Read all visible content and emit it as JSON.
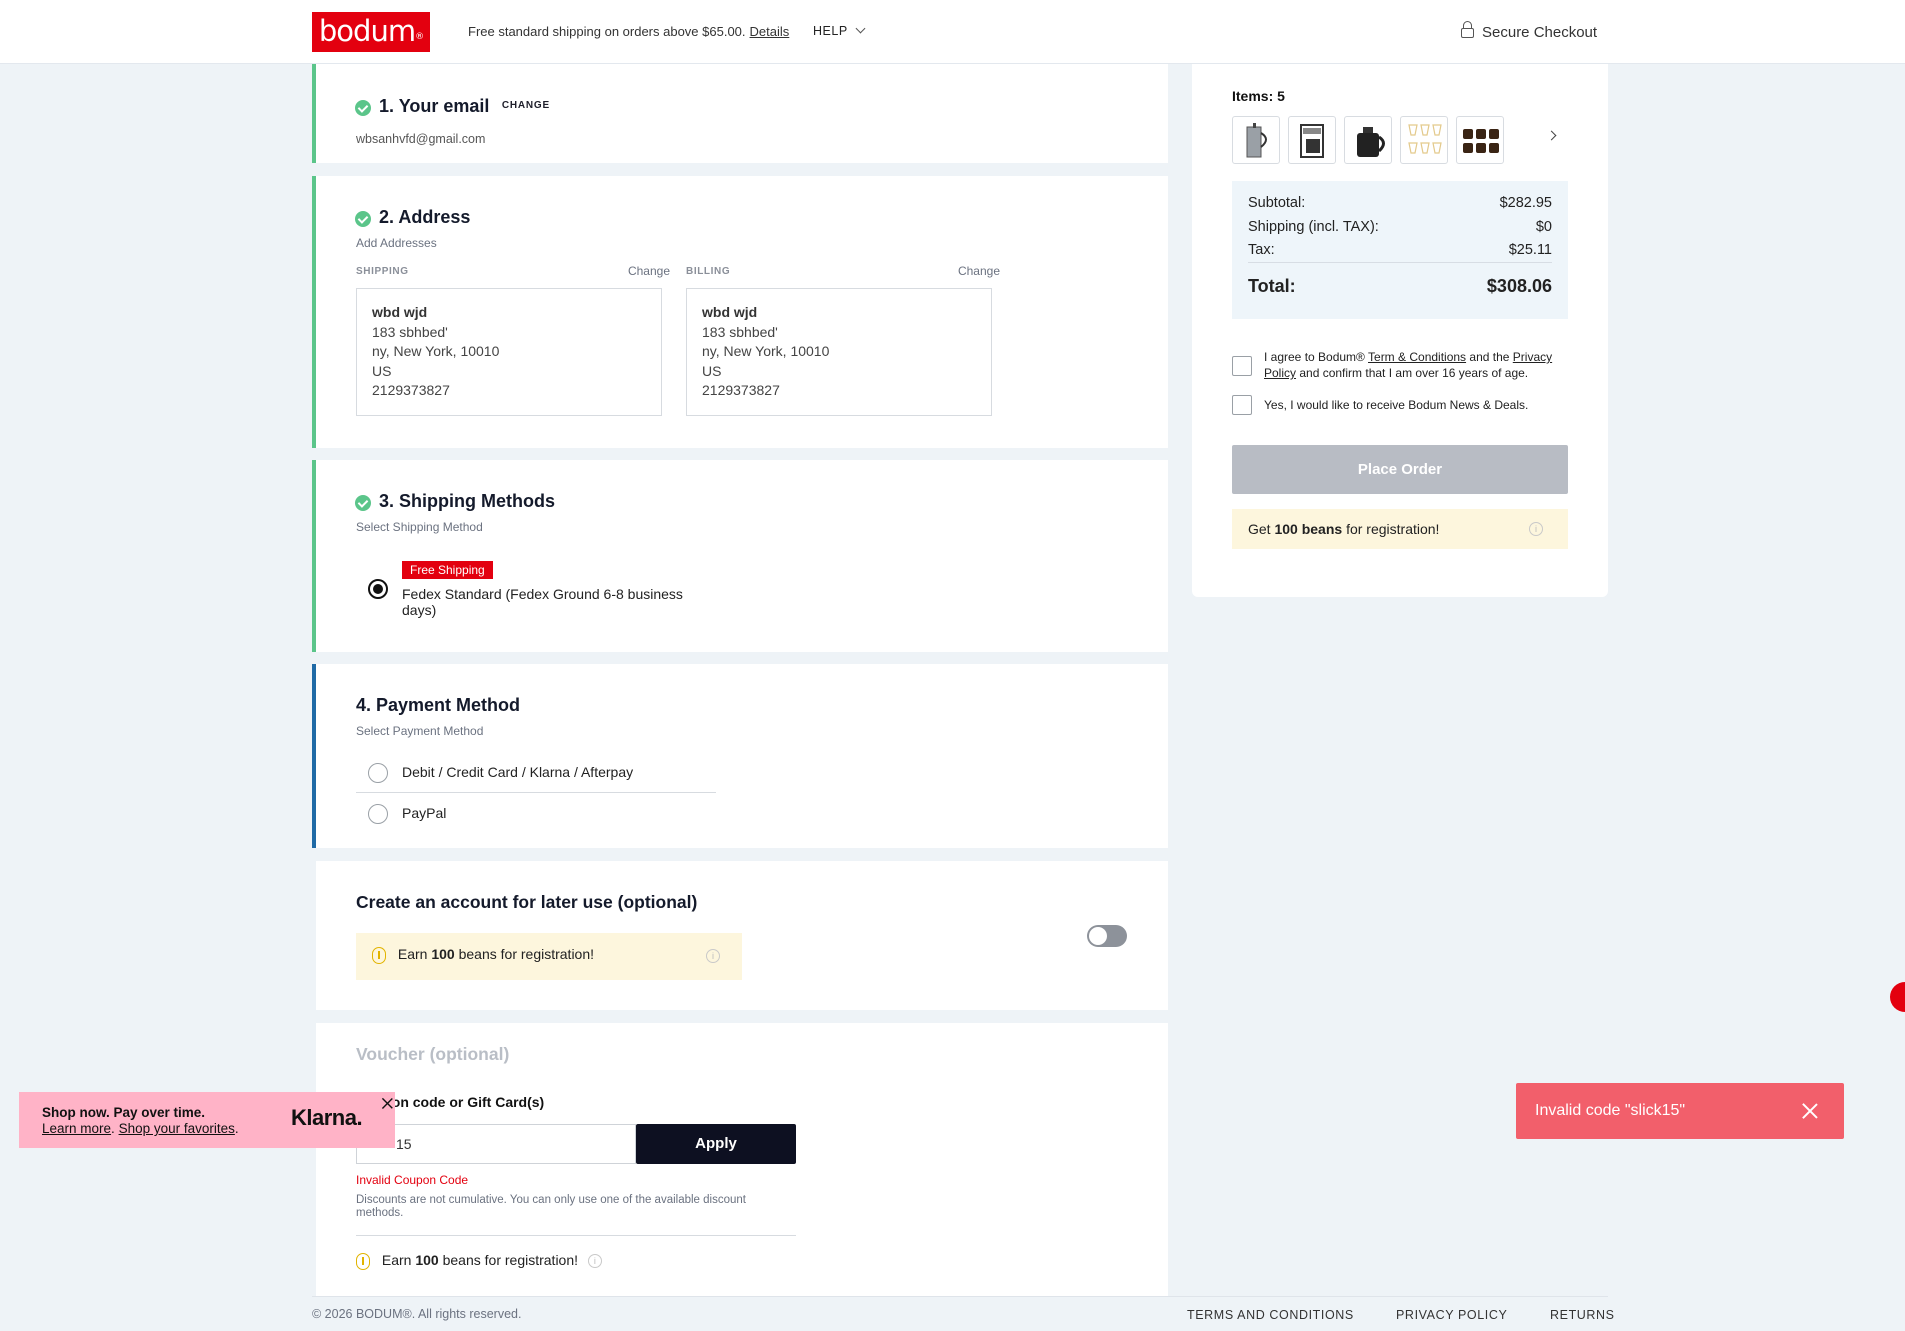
{
  "header": {
    "logo": "bodum",
    "logo_mark": "®",
    "shipping_note": "Free standard shipping on orders above $65.00.",
    "details_link": "Details",
    "help": "HELP",
    "secure_checkout": "Secure Checkout"
  },
  "email_section": {
    "title": "1. Your email",
    "change": "CHANGE",
    "email": "wbsanhvfd@gmail.com"
  },
  "address_section": {
    "title": "2. Address",
    "subtitle": "Add Addresses",
    "shipping_label": "SHIPPING",
    "billing_label": "BILLING",
    "change": "Change",
    "shipping": {
      "name": "wbd wjd",
      "line1": "183 sbhbed'",
      "line2": "ny, New York, 10010",
      "country": "US",
      "phone": "2129373827"
    },
    "billing": {
      "name": "wbd wjd",
      "line1": "183 sbhbed'",
      "line2": "ny, New York, 10010",
      "country": "US",
      "phone": "2129373827"
    }
  },
  "shipping_section": {
    "title": "3. Shipping Methods",
    "subtitle": "Select Shipping Method",
    "badge": "Free Shipping",
    "method_line1": "Fedex Standard (Fedex Ground 6-8 business",
    "method_line2": "days)"
  },
  "payment_section": {
    "title": "4. Payment Method",
    "subtitle": "Select Payment Method",
    "options": [
      "Debit / Credit Card / Klarna / Afterpay",
      "PayPal"
    ]
  },
  "account_section": {
    "title": "Create an account for later use (optional)",
    "beans_pre": "Earn",
    "beans_num": "100",
    "beans_post": "beans for registration!"
  },
  "voucher_section": {
    "title": "Voucher (optional)",
    "coupon_label": "Coupon code or Gift Card(s)",
    "coupon_value": "15",
    "apply": "Apply",
    "error": "Invalid Coupon Code",
    "note": "Discounts are not cumulative. You can only use one of the available discount methods.",
    "beans_pre": "Earn",
    "beans_num": "100",
    "beans_post": "beans for registration!"
  },
  "summary": {
    "items_label": "Items: 5",
    "subtotal_label": "Subtotal:",
    "subtotal": "$282.95",
    "shipping_label": "Shipping (incl. TAX):",
    "shipping": "$0",
    "tax_label": "Tax:",
    "tax": "$25.11",
    "total_label": "Total:",
    "total": "$308.06",
    "agree_pre": "I agree to Bodum® ",
    "terms_link": "Term & Conditions",
    "agree_mid": " and the ",
    "privacy_link_1": "Privacy",
    "privacy_link_2": "Policy",
    "agree_post": " and confirm that I am over 16 years of age.",
    "newsletter": "Yes, I would like to receive Bodum News & Deals.",
    "place_order": "Place Order",
    "beans_pre": "Get",
    "beans_bold": "100 beans",
    "beans_post": "for registration!"
  },
  "toast": {
    "message": "Invalid code \"slick15\""
  },
  "klarna": {
    "headline": "Shop now. Pay over time.",
    "learn_more": "Learn more",
    "shop_favorites": "Shop your favorites",
    "brand": "Klarna."
  },
  "footer": {
    "copyright": "© 2026 BODUM®. All rights reserved.",
    "links": [
      "TERMS AND CONDITIONS",
      "PRIVACY POLICY",
      "RETURNS"
    ]
  },
  "colors": {
    "brand_red": "#e3000f",
    "success_green": "#5bc58a",
    "active_blue": "#1f6aa6",
    "toast_red": "#f25f6b",
    "klarna_pink": "#ffb3c7"
  }
}
